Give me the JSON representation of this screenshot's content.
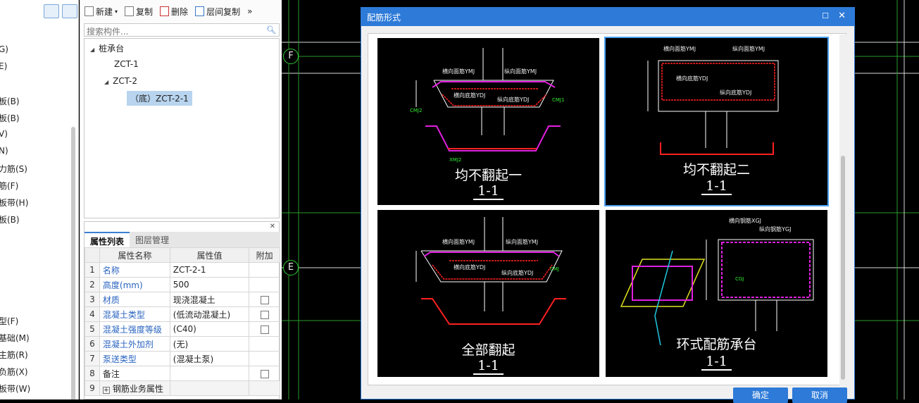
{
  "left_nav": {
    "items": [
      "G)",
      "E)",
      "板(B)",
      "板(B)",
      "V)",
      "N)",
      "力筋(S)",
      "筋(F)",
      "板带(H)",
      "板(B)",
      "型(F)",
      "基础(M)",
      "主筋(R)",
      "负筋(X)",
      "板带(W)"
    ]
  },
  "toolbar": {
    "new_label": "新建",
    "copy_label": "复制",
    "delete_label": "删除",
    "floor_copy_label": "层间复制",
    "more_label": "»"
  },
  "search": {
    "placeholder": "搜索构件..."
  },
  "tree": {
    "root": "桩承台",
    "items": [
      "ZCT-1",
      "ZCT-2"
    ],
    "selected": "（底）ZCT-2-1"
  },
  "props": {
    "tabs": [
      "属性列表",
      "图层管理"
    ],
    "headers": [
      "属性名称",
      "属性值",
      "附加"
    ],
    "rows": [
      {
        "no": "1",
        "name": "名称",
        "value": "ZCT-2-1",
        "check": false
      },
      {
        "no": "2",
        "name": "高度(mm)",
        "value": "500",
        "check": false
      },
      {
        "no": "3",
        "name": "材质",
        "value": "现浇混凝土",
        "check": true
      },
      {
        "no": "4",
        "name": "混凝土类型",
        "value": "(低流动混凝土)",
        "check": true
      },
      {
        "no": "5",
        "name": "混凝土强度等级",
        "value": "(C40)",
        "check": true
      },
      {
        "no": "6",
        "name": "混凝土外加剂",
        "value": "(无)",
        "check": false
      },
      {
        "no": "7",
        "name": "泵送类型",
        "value": "(混凝土泵)",
        "check": false
      },
      {
        "no": "8",
        "name": "备注",
        "value": "",
        "check": true
      },
      {
        "no": "9",
        "name": "钢筋业务属性",
        "value": "",
        "check": false
      }
    ]
  },
  "canvas": {
    "axes": [
      "F",
      "E"
    ]
  },
  "dialog": {
    "title": "配筋形式",
    "cards": [
      {
        "caption": "均不翻起一",
        "section": "1-1",
        "labels": [
          "横向面筋YMJ",
          "纵向面筋YMJ",
          "横向底筋YDJ",
          "纵向底筋YDJ",
          "CMJ2",
          "CMJ1",
          "XMJ2"
        ]
      },
      {
        "caption": "均不翻起二",
        "section": "1-1",
        "labels": [
          "横向面筋YMJ",
          "纵向面筋YMJ",
          "横向底筋YDJ",
          "纵向底筋YDJ"
        ]
      },
      {
        "caption": "全部翻起",
        "section": "1-1",
        "labels": [
          "横向面筋YMJ",
          "纵向面筋YMJ",
          "横向底筋YDJ",
          "纵向底筋YDJ",
          "CMJ"
        ]
      },
      {
        "caption": "环式配筋承台",
        "section": "1-1",
        "labels": [
          "横向钢筋XGJ",
          "纵向钢筋YGJ",
          "CGJ"
        ]
      }
    ],
    "ok_label": "确定",
    "cancel_label": "取消"
  },
  "colors": {
    "accent": "#2d7ad8",
    "rebar": "#ff2020",
    "edge": "#e020e0",
    "dim": "#33ee33"
  }
}
